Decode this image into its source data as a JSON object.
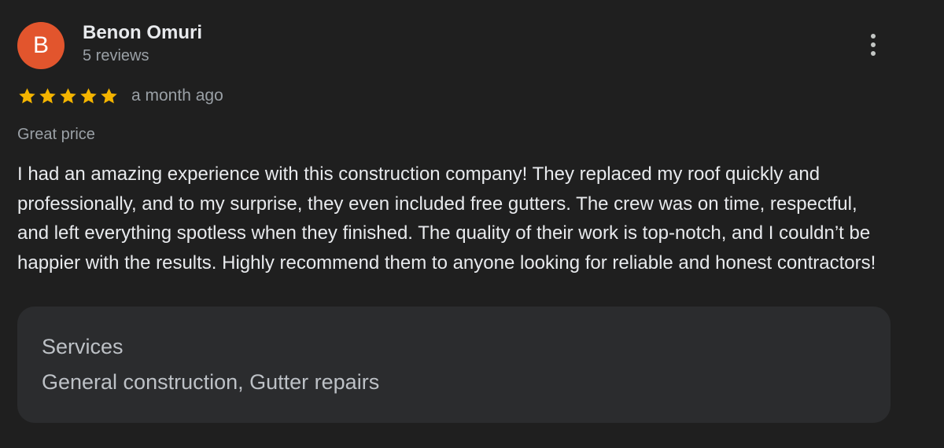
{
  "author": {
    "initial": "B",
    "name": "Benon Omuri",
    "reviews_count": "5 reviews",
    "avatar_color": "#e2552d"
  },
  "menu": {
    "icon": "more-vert-icon"
  },
  "rating": {
    "stars": 5,
    "max": 5,
    "star_color": "#f4b400",
    "time": "a month ago"
  },
  "tag": "Great price",
  "body": "I had an amazing experience with this construction company! They replaced my roof quickly and professionally, and to my surprise, they even included free gutters. The crew was on time, respectful, and left everything spotless when they finished. The quality of their work is top-notch, and I couldn’t be happier with the results. Highly recommend them to anyone looking for reliable and honest contractors!",
  "services": {
    "label": "Services",
    "value": "General construction, Gutter repairs"
  }
}
